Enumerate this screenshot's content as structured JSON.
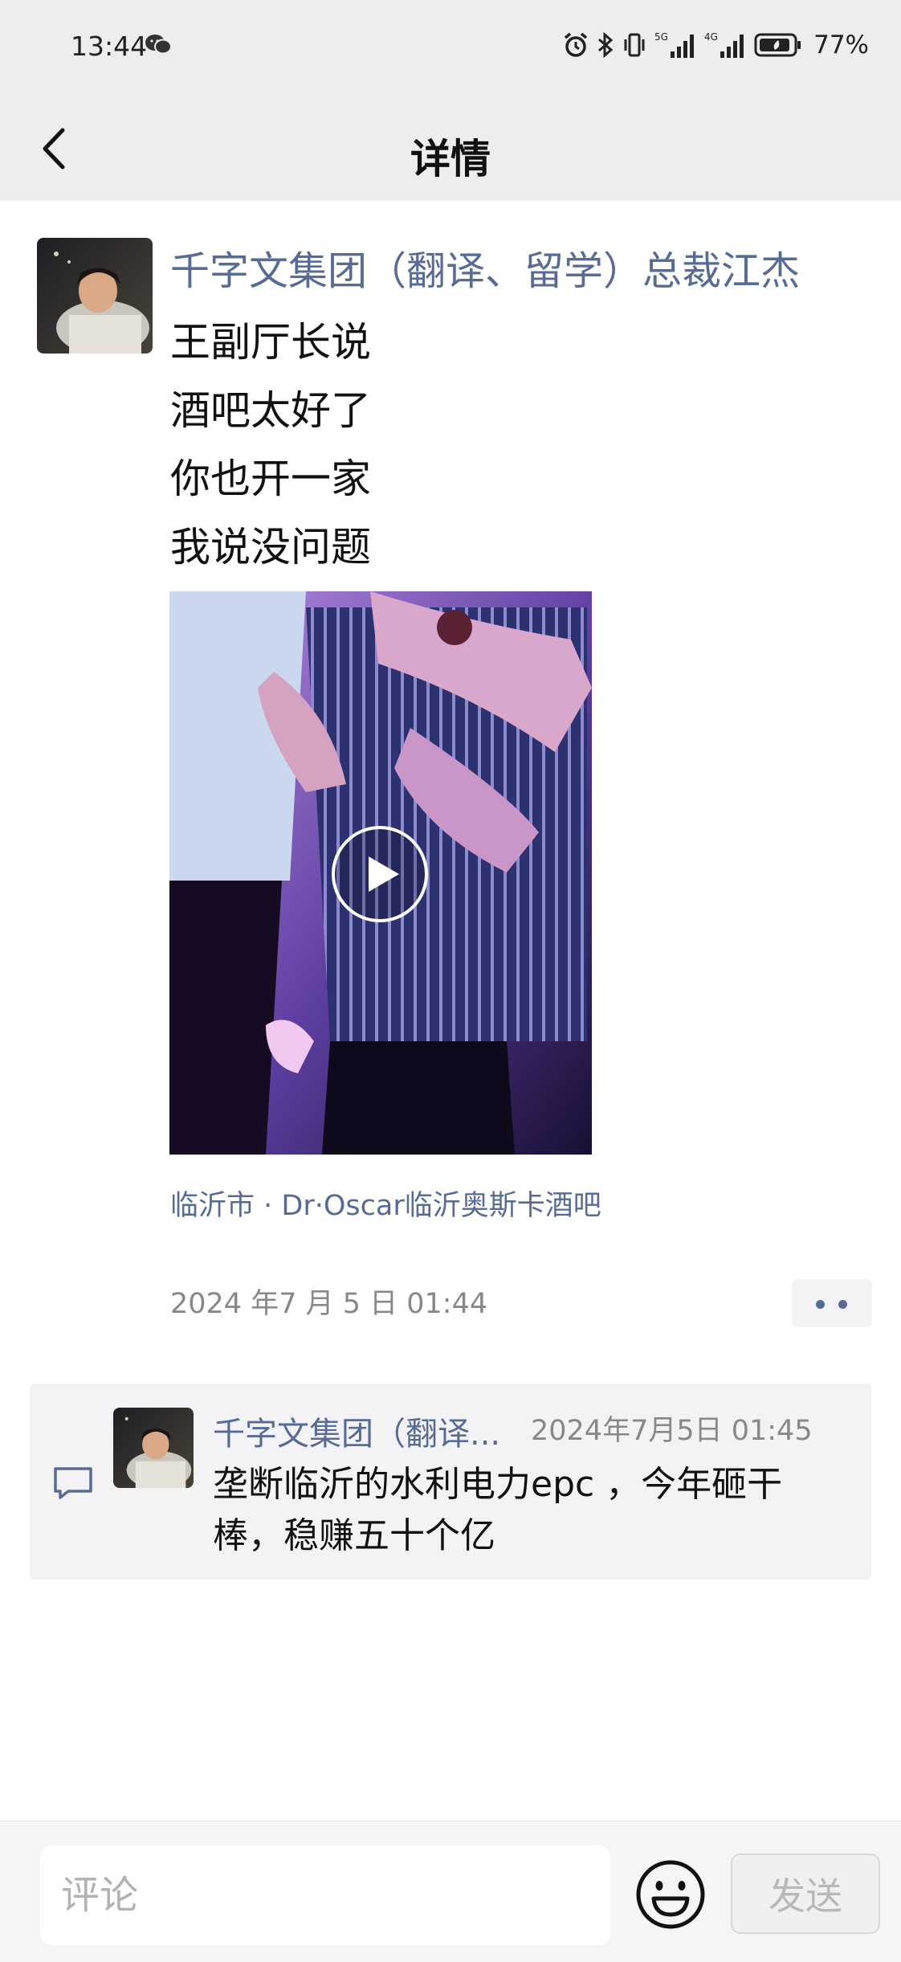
{
  "status_bar": {
    "time": "13:44",
    "battery_percent": "77%",
    "network_labels": [
      "5G",
      "4G"
    ]
  },
  "nav": {
    "title": "详情"
  },
  "post": {
    "author": "千字文集团（翻译、留学）总裁江杰",
    "lines": [
      "王副厅长说",
      "酒吧太好了",
      "你也开一家",
      "我说没问题"
    ],
    "location": "临沂市 · Dr·Oscar临沂奥斯卡酒吧",
    "time": "2024 年7 月 5 日 01:44"
  },
  "comment": {
    "author": "千字文集团（翻译...",
    "time": "2024年7月5日 01:45",
    "text": "垄断临沂的水利电力epc ，今年砸干棒，稳赚五十个亿"
  },
  "input_bar": {
    "placeholder": "评论",
    "send_label": "发送"
  },
  "colors": {
    "link": "#576b95",
    "bar_background": "#ededed",
    "comment_background": "#f3f3f5"
  }
}
